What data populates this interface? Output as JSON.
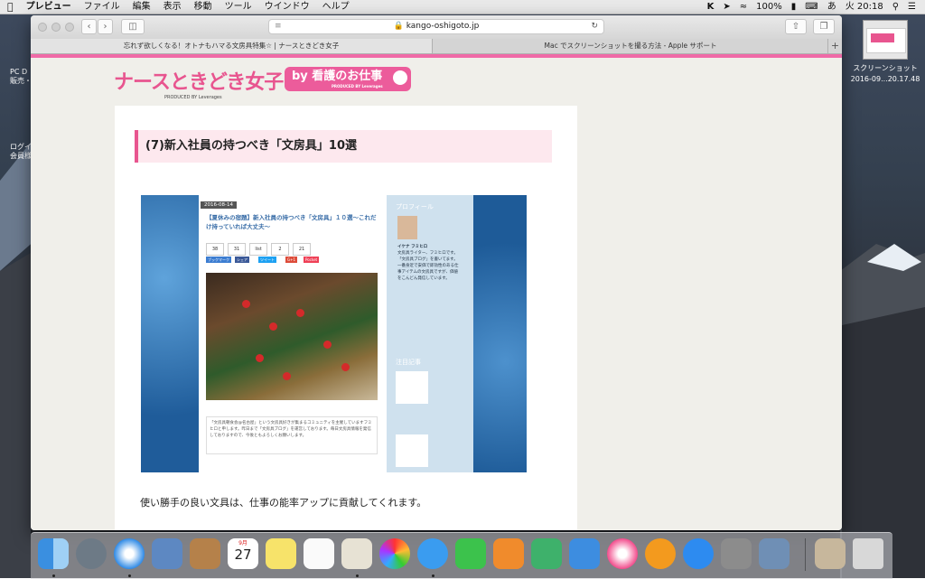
{
  "menubar": {
    "app": "プレビュー",
    "items": [
      "ファイル",
      "編集",
      "表示",
      "移動",
      "ツール",
      "ウインドウ",
      "ヘルプ"
    ],
    "battery": "100%",
    "input_mode": "あ",
    "clock": "火 20:18"
  },
  "desktop": {
    "label1": "PC D",
    "label2": "販売・",
    "label3": "ログイ",
    "label4": "会員様",
    "screenshot_label_line1": "スクリーンショット",
    "screenshot_label_line2": "2016-09...20.17.48"
  },
  "browser": {
    "url": "kango-oshigoto.jp",
    "tabs": [
      {
        "title": "忘れず欲しくなる！オトナもハマる文房具特集☆ | ナースときどき女子"
      },
      {
        "title": "Mac でスクリーンショットを撮る方法 - Apple サポート"
      }
    ],
    "new_tab": "+"
  },
  "site": {
    "logo_text": "ナースときどき女子",
    "logo_produced": "PRODUCED BY Leverages",
    "badge_text": "by 看護のお仕事",
    "badge_sub": "PRODUCED BY Leverages",
    "heading": "(7)新入社員の持つべき「文房具」10選",
    "body_text": "使い勝手の良い文具は、仕事の能率アップに貢献してくれます。"
  },
  "embed": {
    "date": "2016-08-14",
    "title": "【夏休みの宿題】新入社員の持つべき「文房具」１０選〜これだけ持っていれば大丈夫〜",
    "counts": [
      "38",
      "31",
      "list",
      "2",
      "21"
    ],
    "share": [
      "ブックマーク",
      "シェア",
      "ツイート",
      "G+1",
      "Pocket"
    ],
    "caption": "「文房具朝食会@名古屋」という文房具好きが集まるコミュニティを主催していますフミヒロと申します。昨日まで「文房具ブログ」を運営しております。毎日文房具情報を発信しておりますので、今後ともよろしくお願いします。",
    "side_title": "プロフィール",
    "side_name": "イケナ フミヒロ",
    "side_text": "文房具ライター、フミヒロです。「文房具ブログ」を書いてます。一番身近で安価で即効性のある仕事アイテムの文房具ですが、価値をこんどん発信しています。",
    "side_h2": "注目記事"
  },
  "dock": {
    "calendar_day": "27",
    "calendar_month": "9月"
  }
}
